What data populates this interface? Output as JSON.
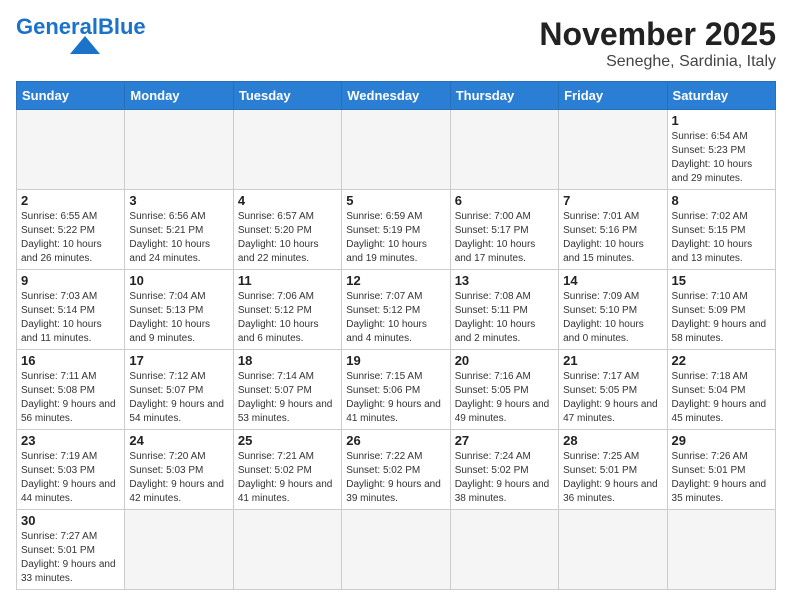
{
  "logo": {
    "text_general": "General",
    "text_blue": "Blue"
  },
  "title": "November 2025",
  "subtitle": "Seneghe, Sardinia, Italy",
  "weekdays": [
    "Sunday",
    "Monday",
    "Tuesday",
    "Wednesday",
    "Thursday",
    "Friday",
    "Saturday"
  ],
  "days": [
    {
      "date": null,
      "info": null
    },
    {
      "date": null,
      "info": null
    },
    {
      "date": null,
      "info": null
    },
    {
      "date": null,
      "info": null
    },
    {
      "date": null,
      "info": null
    },
    {
      "date": null,
      "info": null
    },
    {
      "date": "1",
      "info": "Sunrise: 6:54 AM\nSunset: 5:23 PM\nDaylight: 10 hours and 29 minutes."
    },
    {
      "date": "2",
      "info": "Sunrise: 6:55 AM\nSunset: 5:22 PM\nDaylight: 10 hours and 26 minutes."
    },
    {
      "date": "3",
      "info": "Sunrise: 6:56 AM\nSunset: 5:21 PM\nDaylight: 10 hours and 24 minutes."
    },
    {
      "date": "4",
      "info": "Sunrise: 6:57 AM\nSunset: 5:20 PM\nDaylight: 10 hours and 22 minutes."
    },
    {
      "date": "5",
      "info": "Sunrise: 6:59 AM\nSunset: 5:19 PM\nDaylight: 10 hours and 19 minutes."
    },
    {
      "date": "6",
      "info": "Sunrise: 7:00 AM\nSunset: 5:17 PM\nDaylight: 10 hours and 17 minutes."
    },
    {
      "date": "7",
      "info": "Sunrise: 7:01 AM\nSunset: 5:16 PM\nDaylight: 10 hours and 15 minutes."
    },
    {
      "date": "8",
      "info": "Sunrise: 7:02 AM\nSunset: 5:15 PM\nDaylight: 10 hours and 13 minutes."
    },
    {
      "date": "9",
      "info": "Sunrise: 7:03 AM\nSunset: 5:14 PM\nDaylight: 10 hours and 11 minutes."
    },
    {
      "date": "10",
      "info": "Sunrise: 7:04 AM\nSunset: 5:13 PM\nDaylight: 10 hours and 9 minutes."
    },
    {
      "date": "11",
      "info": "Sunrise: 7:06 AM\nSunset: 5:12 PM\nDaylight: 10 hours and 6 minutes."
    },
    {
      "date": "12",
      "info": "Sunrise: 7:07 AM\nSunset: 5:12 PM\nDaylight: 10 hours and 4 minutes."
    },
    {
      "date": "13",
      "info": "Sunrise: 7:08 AM\nSunset: 5:11 PM\nDaylight: 10 hours and 2 minutes."
    },
    {
      "date": "14",
      "info": "Sunrise: 7:09 AM\nSunset: 5:10 PM\nDaylight: 10 hours and 0 minutes."
    },
    {
      "date": "15",
      "info": "Sunrise: 7:10 AM\nSunset: 5:09 PM\nDaylight: 9 hours and 58 minutes."
    },
    {
      "date": "16",
      "info": "Sunrise: 7:11 AM\nSunset: 5:08 PM\nDaylight: 9 hours and 56 minutes."
    },
    {
      "date": "17",
      "info": "Sunrise: 7:12 AM\nSunset: 5:07 PM\nDaylight: 9 hours and 54 minutes."
    },
    {
      "date": "18",
      "info": "Sunrise: 7:14 AM\nSunset: 5:07 PM\nDaylight: 9 hours and 53 minutes."
    },
    {
      "date": "19",
      "info": "Sunrise: 7:15 AM\nSunset: 5:06 PM\nDaylight: 9 hours and 41 minutes."
    },
    {
      "date": "20",
      "info": "Sunrise: 7:16 AM\nSunset: 5:05 PM\nDaylight: 9 hours and 49 minutes."
    },
    {
      "date": "21",
      "info": "Sunrise: 7:17 AM\nSunset: 5:05 PM\nDaylight: 9 hours and 47 minutes."
    },
    {
      "date": "22",
      "info": "Sunrise: 7:18 AM\nSunset: 5:04 PM\nDaylight: 9 hours and 45 minutes."
    },
    {
      "date": "23",
      "info": "Sunrise: 7:19 AM\nSunset: 5:03 PM\nDaylight: 9 hours and 44 minutes."
    },
    {
      "date": "24",
      "info": "Sunrise: 7:20 AM\nSunset: 5:03 PM\nDaylight: 9 hours and 42 minutes."
    },
    {
      "date": "25",
      "info": "Sunrise: 7:21 AM\nSunset: 5:02 PM\nDaylight: 9 hours and 41 minutes."
    },
    {
      "date": "26",
      "info": "Sunrise: 7:22 AM\nSunset: 5:02 PM\nDaylight: 9 hours and 39 minutes."
    },
    {
      "date": "27",
      "info": "Sunrise: 7:24 AM\nSunset: 5:02 PM\nDaylight: 9 hours and 38 minutes."
    },
    {
      "date": "28",
      "info": "Sunrise: 7:25 AM\nSunset: 5:01 PM\nDaylight: 9 hours and 36 minutes."
    },
    {
      "date": "29",
      "info": "Sunrise: 7:26 AM\nSunset: 5:01 PM\nDaylight: 9 hours and 35 minutes."
    },
    {
      "date": "30",
      "info": "Sunrise: 7:27 AM\nSunset: 5:01 PM\nDaylight: 9 hours and 33 minutes."
    },
    {
      "date": null,
      "info": null
    },
    {
      "date": null,
      "info": null
    },
    {
      "date": null,
      "info": null
    },
    {
      "date": null,
      "info": null
    },
    {
      "date": null,
      "info": null
    },
    {
      "date": null,
      "info": null
    }
  ]
}
